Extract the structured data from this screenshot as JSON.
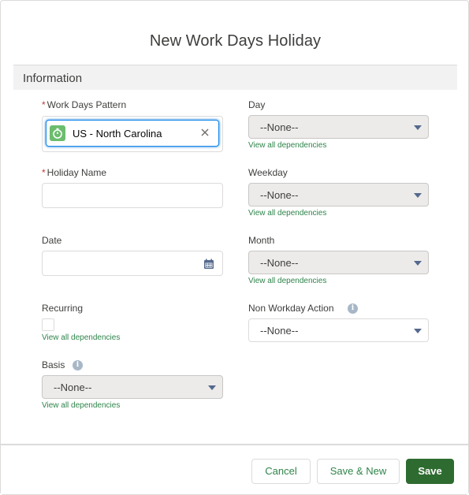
{
  "modal": {
    "title": "New Work Days Holiday"
  },
  "section": {
    "title": "Information"
  },
  "fields": {
    "work_days_pattern": {
      "label": "Work Days Pattern",
      "required_mark": "*",
      "value": "US - North Carolina"
    },
    "holiday_name": {
      "label": "Holiday Name",
      "required_mark": "*",
      "value": ""
    },
    "date": {
      "label": "Date",
      "value": ""
    },
    "recurring": {
      "label": "Recurring",
      "checked": false,
      "dependencies_link": "View all dependencies"
    },
    "basis": {
      "label": "Basis",
      "value": "--None--",
      "dependencies_link": "View all dependencies"
    },
    "day": {
      "label": "Day",
      "value": "--None--",
      "dependencies_link": "View all dependencies"
    },
    "weekday": {
      "label": "Weekday",
      "value": "--None--",
      "dependencies_link": "View all dependencies"
    },
    "month": {
      "label": "Month",
      "value": "--None--",
      "dependencies_link": "View all dependencies"
    },
    "non_workday_action": {
      "label": "Non Workday Action",
      "value": "--None--"
    }
  },
  "footer": {
    "cancel_label": "Cancel",
    "save_new_label": "Save & New",
    "save_label": "Save"
  },
  "icons": {
    "lookup_object": "stopwatch-icon",
    "clear": "close-icon",
    "date_picker": "calendar-icon",
    "help": "info-icon",
    "dropdown": "chevron-down-icon"
  },
  "colors": {
    "brand_button": "#2e6b30",
    "link": "#2e844a",
    "required": "#c23934",
    "focus": "#1589ee"
  }
}
